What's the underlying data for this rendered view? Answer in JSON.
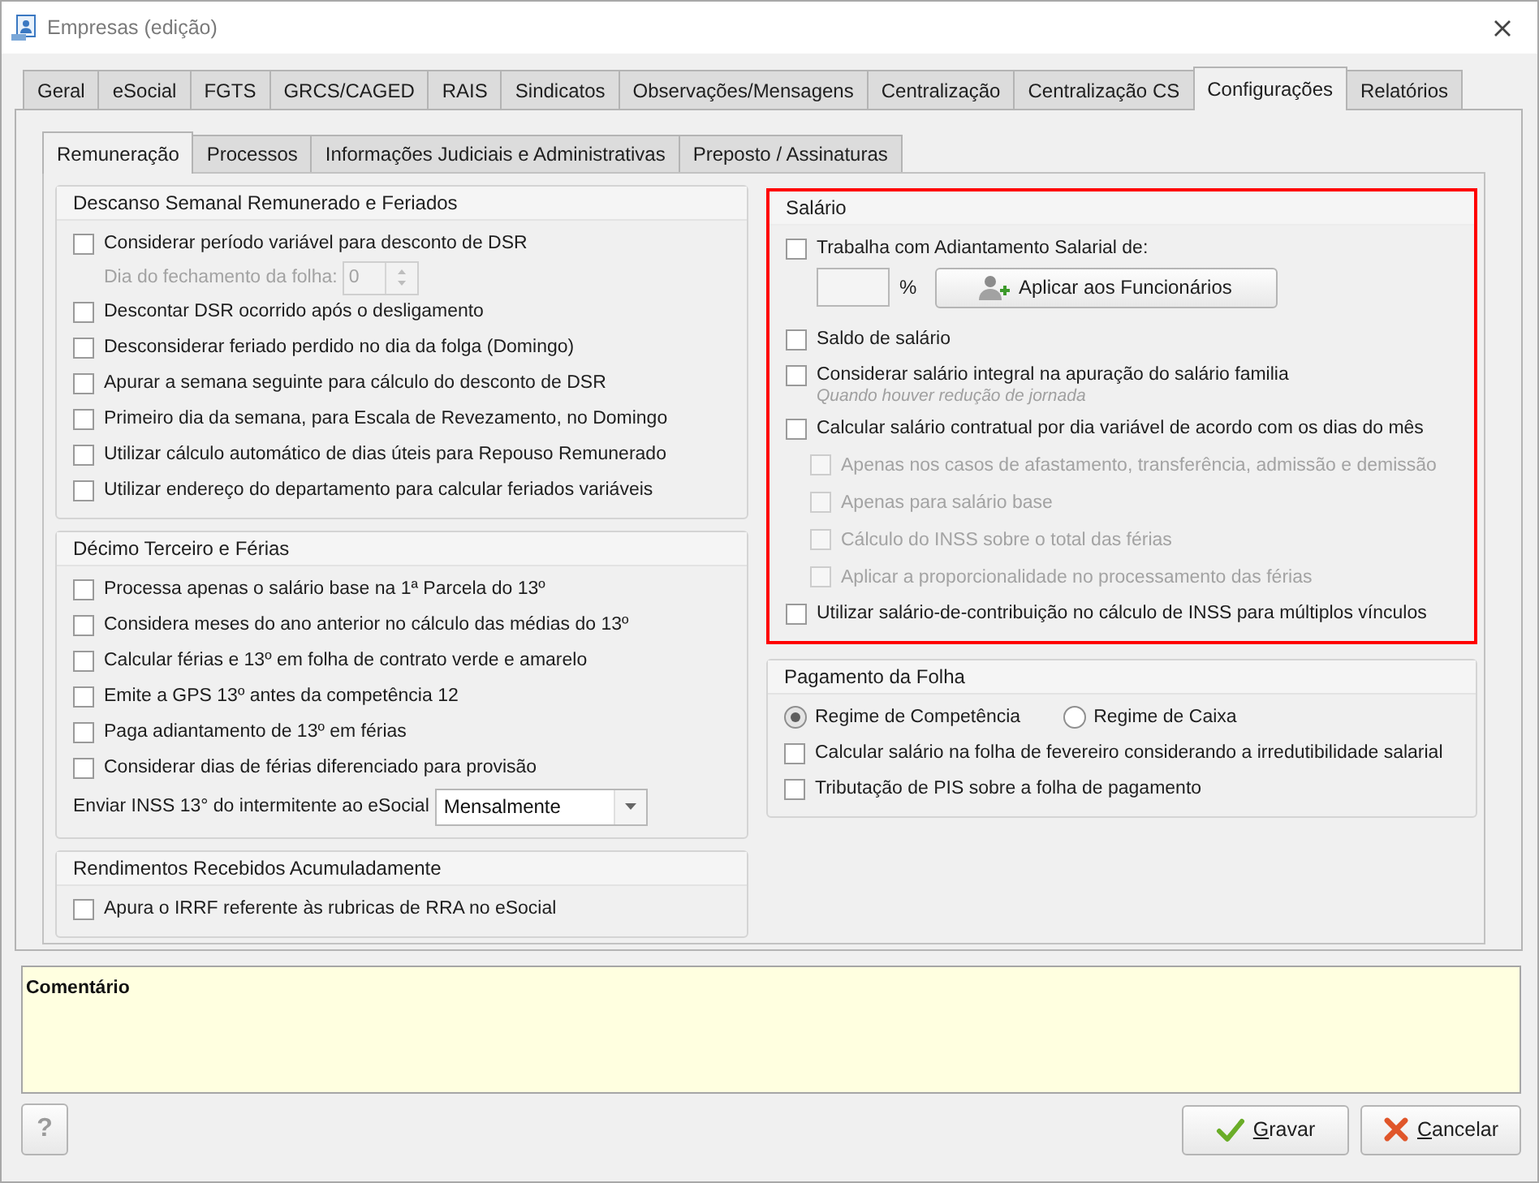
{
  "window": {
    "title": "Empresas (edição)"
  },
  "tabs": [
    {
      "label": "Geral",
      "selected": false
    },
    {
      "label": "eSocial",
      "selected": false
    },
    {
      "label": "FGTS",
      "selected": false
    },
    {
      "label": "GRCS/CAGED",
      "selected": false
    },
    {
      "label": "RAIS",
      "selected": false
    },
    {
      "label": "Sindicatos",
      "selected": false
    },
    {
      "label": "Observações/Mensagens",
      "selected": false
    },
    {
      "label": "Centralização",
      "selected": false
    },
    {
      "label": "Centralização CS",
      "selected": false
    },
    {
      "label": "Configurações",
      "selected": true
    },
    {
      "label": "Relatórios",
      "selected": false
    }
  ],
  "subtabs": [
    {
      "label": "Remuneração",
      "selected": true
    },
    {
      "label": "Processos",
      "selected": false
    },
    {
      "label": "Informações Judiciais e Administrativas",
      "selected": false
    },
    {
      "label": "Preposto / Assinaturas",
      "selected": false
    }
  ],
  "left_column": [
    {
      "title": "Descanso Semanal Remunerado e Feriados",
      "highlighted": false,
      "items": [
        {
          "kind": "checkbox",
          "label": "Considerar período variável para desconto de DSR",
          "checked": false,
          "disabled": false
        },
        {
          "kind": "spinner",
          "label": "Dia do fechamento da folha:",
          "value": "0",
          "disabled": true
        },
        {
          "kind": "checkbox",
          "label": "Descontar DSR ocorrido após o desligamento",
          "checked": false,
          "disabled": false
        },
        {
          "kind": "checkbox",
          "label": "Desconsiderar feriado perdido no dia da folga (Domingo)",
          "checked": false,
          "disabled": false
        },
        {
          "kind": "checkbox",
          "label": "Apurar a semana seguinte para cálculo do desconto de DSR",
          "checked": false,
          "disabled": false
        },
        {
          "kind": "checkbox",
          "label": "Primeiro dia da semana, para Escala de Revezamento, no Domingo",
          "checked": false,
          "disabled": false
        },
        {
          "kind": "checkbox",
          "label": "Utilizar cálculo automático de dias úteis para Repouso Remunerado",
          "checked": false,
          "disabled": false
        },
        {
          "kind": "checkbox",
          "label": "Utilizar endereço do departamento para calcular feriados variáveis",
          "checked": false,
          "disabled": false
        }
      ]
    },
    {
      "title": "Décimo Terceiro e Férias",
      "highlighted": false,
      "items": [
        {
          "kind": "checkbox",
          "label": "Processa apenas o salário base na 1ª Parcela do 13º",
          "checked": false,
          "disabled": false
        },
        {
          "kind": "checkbox",
          "label": "Considera meses do ano anterior no cálculo das médias do 13º",
          "checked": false,
          "disabled": false
        },
        {
          "kind": "checkbox",
          "label": "Calcular férias e 13º em folha de contrato verde e amarelo",
          "checked": false,
          "disabled": false
        },
        {
          "kind": "checkbox",
          "label": "Emite a GPS 13º antes da competência 12",
          "checked": false,
          "disabled": false
        },
        {
          "kind": "checkbox",
          "label": "Paga adiantamento de 13º em férias",
          "checked": false,
          "disabled": false
        },
        {
          "kind": "checkbox",
          "label": "Considerar dias de férias diferenciado para provisão",
          "checked": false,
          "disabled": false
        },
        {
          "kind": "select",
          "label": "Enviar INSS 13° do intermitente ao eSocial",
          "value": "Mensalmente"
        }
      ]
    },
    {
      "title": "Rendimentos Recebidos Acumuladamente",
      "highlighted": false,
      "items": [
        {
          "kind": "checkbox",
          "label": "Apura o IRRF referente às rubricas de RRA no eSocial",
          "checked": false,
          "disabled": false
        }
      ]
    }
  ],
  "right_column": [
    {
      "title": "Salário",
      "highlighted": true,
      "items": [
        {
          "kind": "checkbox",
          "label": "Trabalha com Adiantamento Salarial de:",
          "checked": false,
          "disabled": false
        },
        {
          "kind": "percent",
          "unit": "%",
          "button": "Aplicar aos Funcionários"
        },
        {
          "kind": "checkbox",
          "label": "Saldo de salário",
          "checked": false,
          "disabled": false
        },
        {
          "kind": "checkbox",
          "label": "Considerar salário integral na apuração do salário familia",
          "hint": "Quando houver redução de jornada",
          "checked": false,
          "disabled": false
        },
        {
          "kind": "checkbox",
          "label": "Calcular salário contratual por dia variável de acordo com os dias do mês",
          "checked": false,
          "disabled": false,
          "children": [
            {
              "label": "Apenas nos casos de afastamento, transferência, admissão e demissão",
              "checked": false,
              "disabled": true
            },
            {
              "label": "Apenas para salário base",
              "checked": false,
              "disabled": true
            },
            {
              "label": "Cálculo do INSS sobre o total das férias",
              "checked": false,
              "disabled": true
            },
            {
              "label": "Aplicar a proporcionalidade no processamento das férias",
              "checked": false,
              "disabled": true
            }
          ]
        },
        {
          "kind": "checkbox",
          "label": "Utilizar salário-de-contribuição no cálculo de INSS para múltiplos vínculos",
          "checked": false,
          "disabled": false
        }
      ]
    },
    {
      "title": "Pagamento da Folha",
      "highlighted": false,
      "items": [
        {
          "kind": "radios",
          "options": [
            {
              "label": "Regime de Competência",
              "selected": true
            },
            {
              "label": "Regime de Caixa",
              "selected": false
            }
          ]
        },
        {
          "kind": "checkbox",
          "label": "Calcular salário na folha de fevereiro considerando a irredutibilidade salarial",
          "checked": false,
          "disabled": false
        },
        {
          "kind": "checkbox",
          "label": "Tributação de PIS sobre a folha de pagamento",
          "checked": false,
          "disabled": false
        }
      ]
    }
  ],
  "footer": {
    "comment_label": "Comentário",
    "help_label": "?",
    "buttons": [
      {
        "kind": "save",
        "label": "Gravar",
        "access_key_underlined": true
      },
      {
        "kind": "cancel",
        "label": "Cancelar",
        "access_key_underlined": true
      }
    ]
  }
}
